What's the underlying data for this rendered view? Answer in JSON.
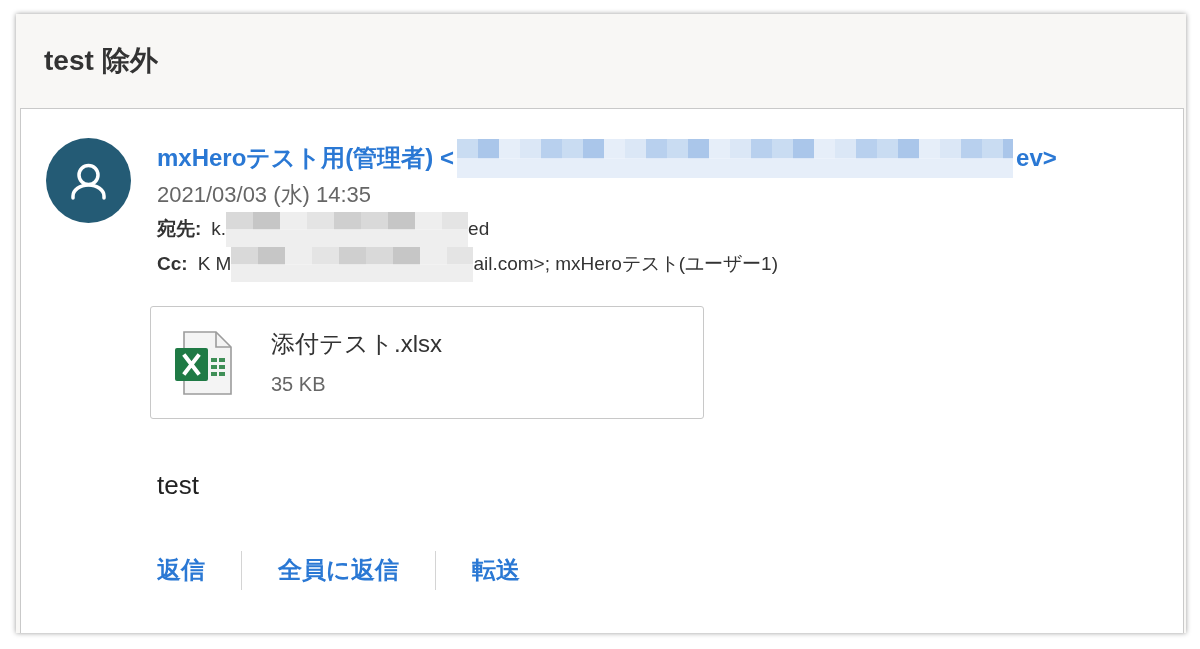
{
  "subject": "test 除外",
  "message": {
    "sender": [
      {
        "kind": "text",
        "text": "mxHeroテスト用(管理者) <"
      },
      {
        "kind": "redacted"
      },
      {
        "kind": "text",
        "text": "ev>"
      }
    ],
    "date": "2021/03/03 (水) 14:35",
    "recipients": [
      {
        "label": "宛先:",
        "parts": [
          {
            "kind": "text",
            "text": "k."
          },
          {
            "kind": "redacted"
          },
          {
            "kind": "text",
            "text": "ed"
          }
        ]
      },
      {
        "label": "Cc:",
        "parts": [
          {
            "kind": "text",
            "text": "K M"
          },
          {
            "kind": "redacted"
          },
          {
            "kind": "text",
            "text": "ail.com>; mxHeroテスト(ユーザー1)"
          }
        ]
      }
    ],
    "attachments": [
      {
        "name": "添付テスト.xlsx",
        "size": "35 KB"
      }
    ],
    "body": "test",
    "actions": [
      "返信",
      "全員に返信",
      "転送"
    ]
  }
}
